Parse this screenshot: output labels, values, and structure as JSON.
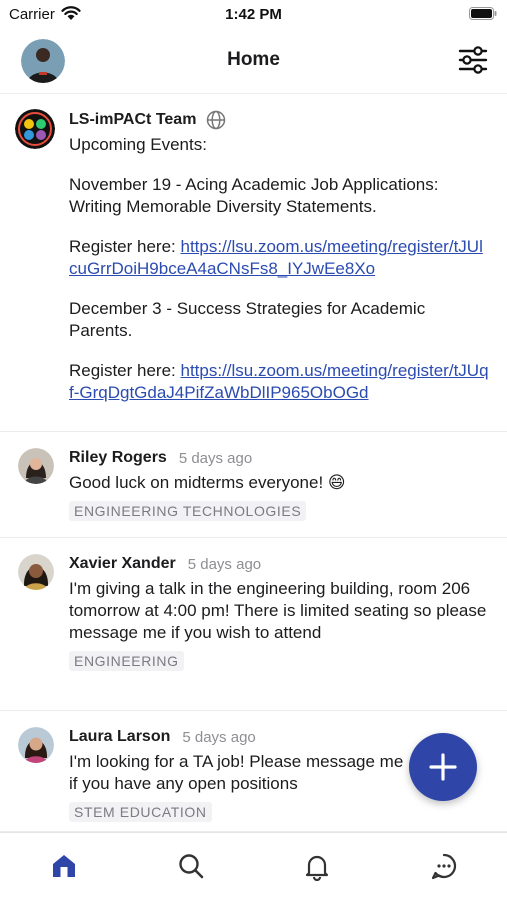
{
  "status_bar": {
    "carrier": "Carrier",
    "time": "1:42 PM"
  },
  "nav": {
    "title": "Home"
  },
  "posts": [
    {
      "author": "LS-imPACt Team",
      "paragraphs": [
        "Upcoming Events:",
        "November 19 - Acing Academic Job Applications: Writing Memorable Diversity Statements."
      ],
      "register_1_prefix": "Register here: ",
      "register_1_link": "https://lsu.zoom.us/meeting/register/tJUlcuGrrDoiH9bceA4aCNsFs8_IYJwEe8Xo",
      "paragraph_3": "December 3 - Success Strategies for Academic Parents.",
      "register_2_prefix": "Register here: ",
      "register_2_link": "https://lsu.zoom.us/meeting/register/tJUqf-GrqDgtGdaJ4PifZaWbDlIP965ObOGd"
    },
    {
      "author": "Riley Rogers",
      "time": "5 days ago",
      "text": "Good luck on midterms everyone! 😄",
      "tag": "ENGINEERING TECHNOLOGIES"
    },
    {
      "author": "Xavier Xander",
      "time": "5 days ago",
      "text": "I'm giving a talk in the engineering building, room 206 tomorrow at 4:00 pm! There is limited seating so please message me if you wish to attend",
      "tag": "ENGINEERING"
    },
    {
      "author": "Laura Larson",
      "time": "5 days ago",
      "text": "I'm looking for a TA job! Please message me if you have any open positions",
      "tag": "STEM EDUCATION"
    }
  ],
  "colors": {
    "accent": "#2f46a8",
    "link": "#2b4bb0",
    "tag_bg": "#f2f2f4",
    "tab_active": "#2f46a8",
    "tab_inactive": "#8e8e93"
  },
  "tabs": [
    {
      "icon": "home-icon",
      "active": true
    },
    {
      "icon": "search-icon",
      "active": false
    },
    {
      "icon": "bell-icon",
      "active": false
    },
    {
      "icon": "chat-bubble-icon",
      "active": false
    }
  ]
}
